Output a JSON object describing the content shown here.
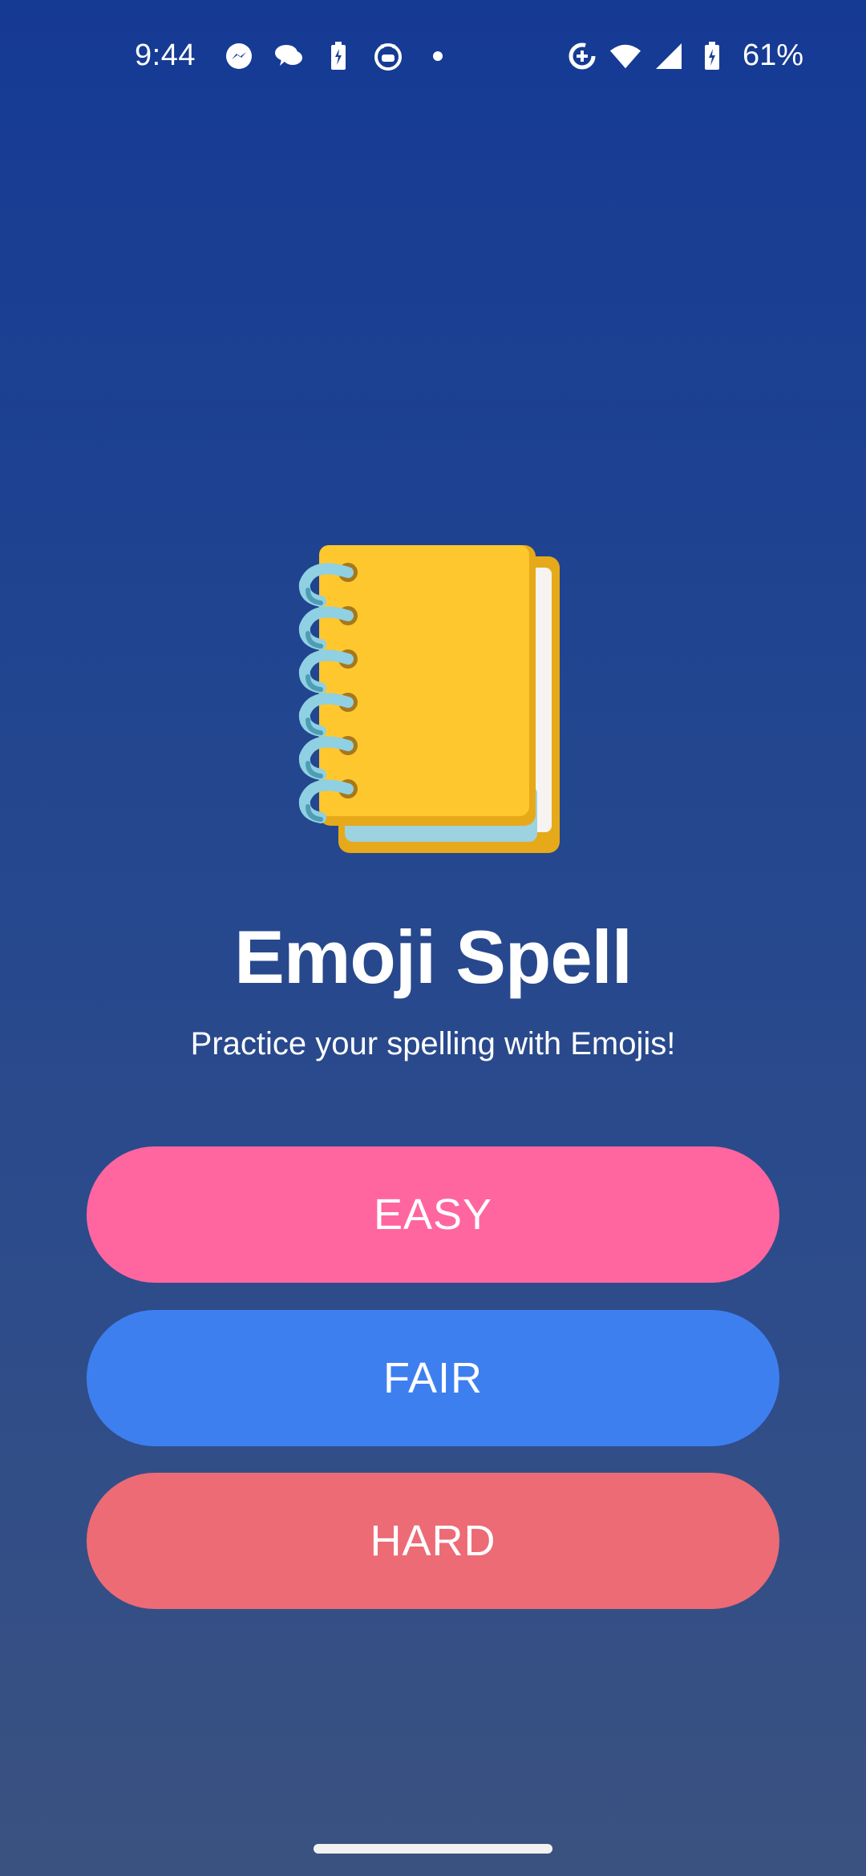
{
  "status_bar": {
    "time": "9:44",
    "battery": "61%",
    "left_icons": [
      "messenger-icon",
      "chat-icon",
      "battery-saver-icon",
      "cat-face-icon",
      "dot-icon"
    ],
    "right_icons": [
      "data-saver-icon",
      "wifi-icon",
      "signal-icon",
      "battery-charging-icon"
    ]
  },
  "app": {
    "title": "Emoji Spell",
    "subtitle": "Practice your spelling with Emojis!",
    "logo_icon": "spiral-notepad-icon"
  },
  "buttons": {
    "easy": {
      "label": "EASY",
      "color": "#ff669f"
    },
    "fair": {
      "label": "FAIR",
      "color": "#3e7ff0"
    },
    "hard": {
      "label": "HARD",
      "color": "#ec6b75"
    }
  },
  "colors": {
    "background_top": "#153a94",
    "background_bottom": "#3a5280"
  }
}
